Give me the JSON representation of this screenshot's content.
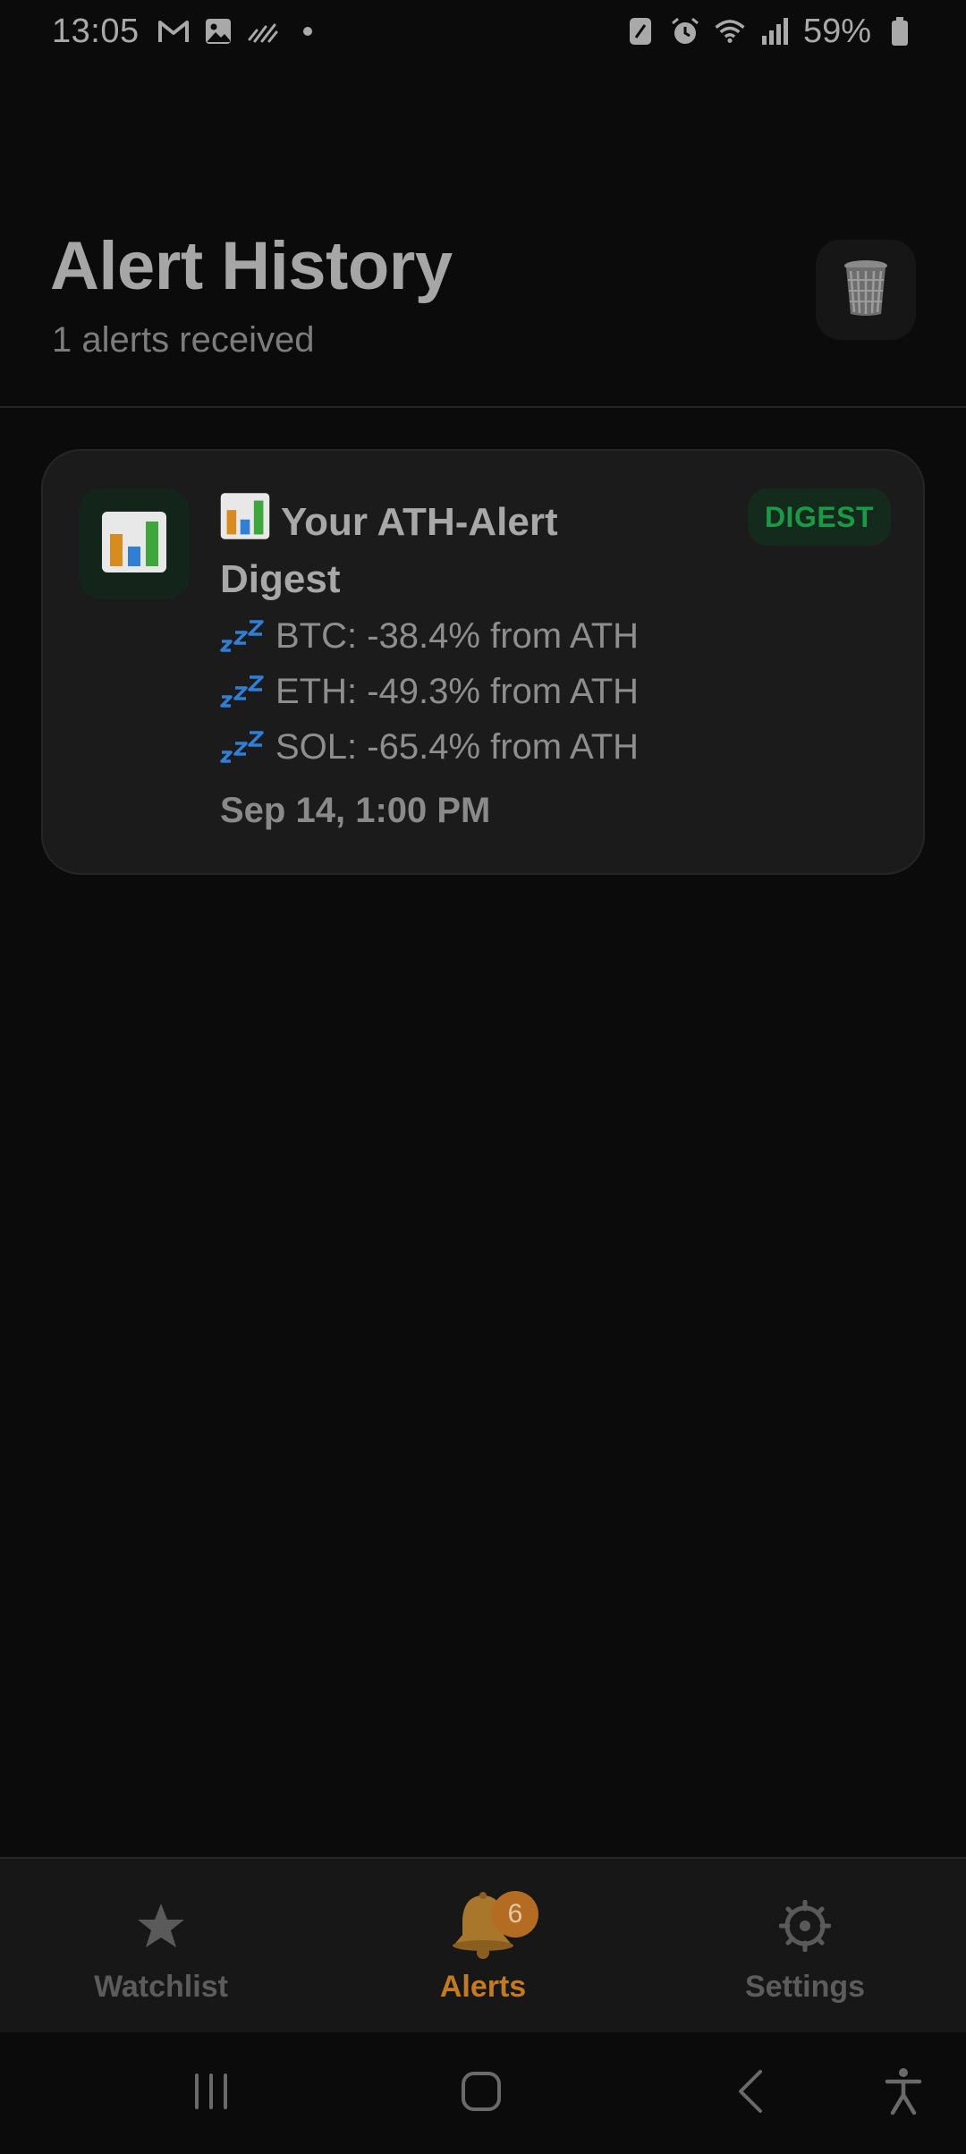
{
  "status_bar": {
    "time": "13:05",
    "battery": "59%",
    "left_icons": [
      "gmail-icon",
      "gallery-icon",
      "activity-icon",
      "dot-icon"
    ],
    "right_icons": [
      "nfc-icon",
      "alarm-icon",
      "wifi-icon",
      "signal-icon",
      "battery-icon"
    ]
  },
  "header": {
    "title": "Alert History",
    "subtitle": "1 alerts received",
    "action_icon": "trash-icon"
  },
  "alerts": [
    {
      "icon": "bar-chart-icon",
      "title": "Your ATH-Alert Digest",
      "badge": "DIGEST",
      "lines": [
        "BTC: -38.4% from ATH",
        "ETH: -49.3% from ATH",
        "SOL: -65.4% from ATH"
      ],
      "line_icon": "zzz-icon",
      "time": "Sep 14, 1:00 PM"
    }
  ],
  "bottom_nav": {
    "tabs": [
      {
        "label": "Watchlist",
        "icon": "star-icon",
        "active": false
      },
      {
        "label": "Alerts",
        "icon": "bell-icon",
        "active": true,
        "badge": "6"
      },
      {
        "label": "Settings",
        "icon": "gear-icon",
        "active": false
      }
    ]
  },
  "colors": {
    "background": "#0b0b0b",
    "card": "#1b1b1b",
    "accent": "#c47a1e",
    "badge_green": "#1a9a45"
  }
}
